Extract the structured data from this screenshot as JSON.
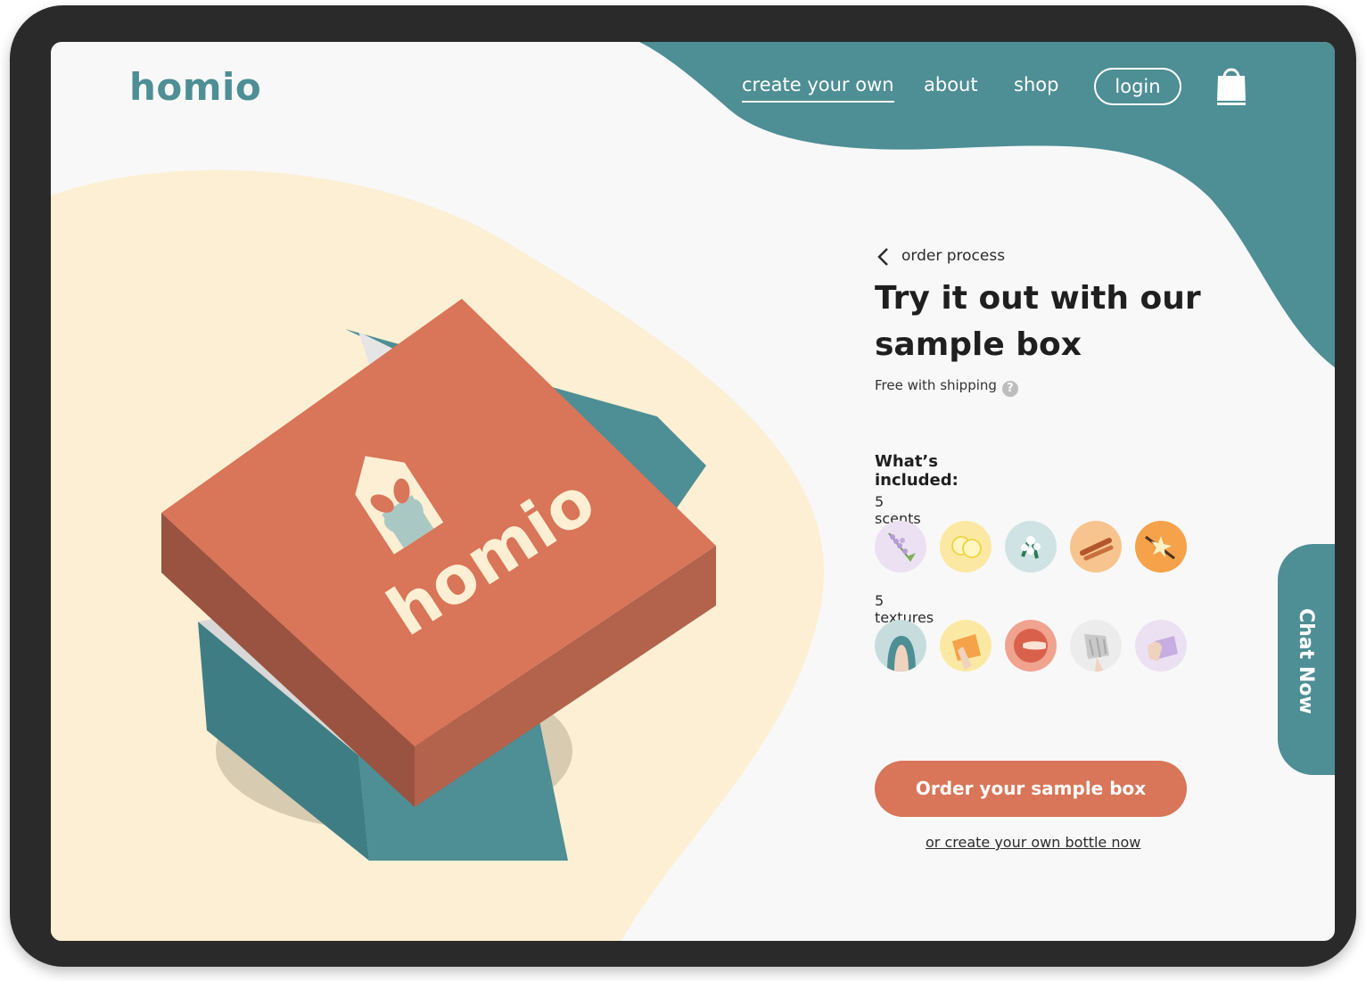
{
  "brand": {
    "logo": "homio",
    "box_logo": "homio"
  },
  "nav": {
    "items": [
      {
        "label": "create your own",
        "active": true
      },
      {
        "label": "about"
      },
      {
        "label": "shop"
      }
    ],
    "login": "login",
    "cart_icon": "shopping-bag-icon"
  },
  "product": {
    "breadcrumb": "order process",
    "title": "Try it out with our sample box",
    "shipping_note": "Free with shipping",
    "help_icon": "question-icon",
    "included_heading": "What’s included:",
    "scents_label": "5 scents",
    "scents": [
      "lavender",
      "lemon",
      "jasmine",
      "cinnamon",
      "vanilla"
    ],
    "textures_label": "5 textures",
    "textures": [
      "gel",
      "cream",
      "balm",
      "foam",
      "bar"
    ],
    "order_button": "Order your sample box",
    "create_link": "or create your own bottle now"
  },
  "chat": {
    "label": "Chat Now"
  },
  "colors": {
    "teal": "#4e8e95",
    "coral": "#d97558",
    "cream": "#fdefd3",
    "background": "#f8f8f8"
  }
}
